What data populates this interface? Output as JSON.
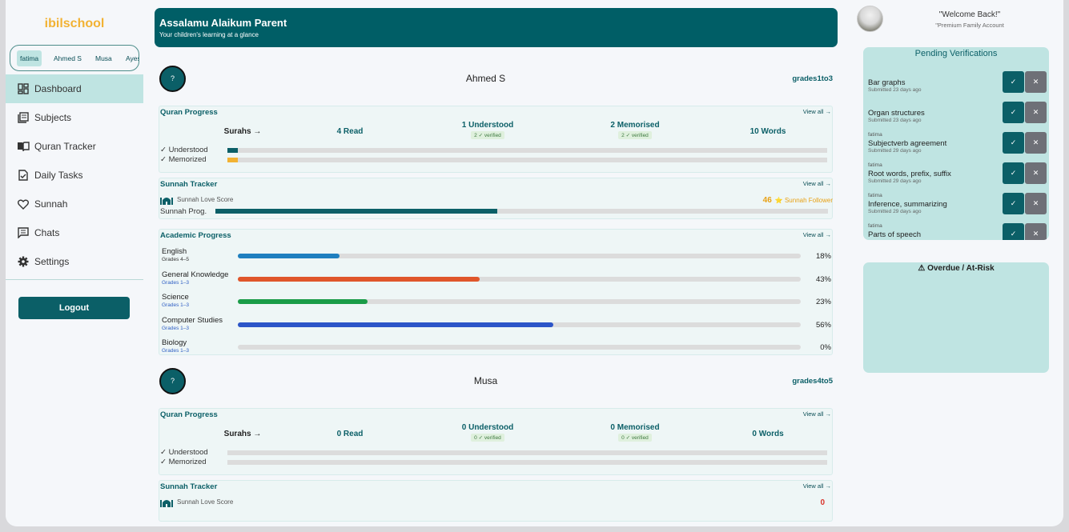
{
  "brand": "ibilschool",
  "child_tabs": [
    "fatima",
    "Ahmed S",
    "Musa",
    "Ayesha"
  ],
  "nav": [
    {
      "label": "Dashboard",
      "icon": "dashboard-icon"
    },
    {
      "label": "Subjects",
      "icon": "books-icon"
    },
    {
      "label": "Quran Tracker",
      "icon": "open-book-icon"
    },
    {
      "label": "Daily Tasks",
      "icon": "task-icon"
    },
    {
      "label": "Sunnah",
      "icon": "heart-icon"
    },
    {
      "label": "Chats",
      "icon": "chat-icon"
    },
    {
      "label": "Settings",
      "icon": "gear-icon"
    }
  ],
  "logout": "Logout",
  "banner": {
    "title": "Assalamu Alaikum Parent",
    "subtitle": "Your children's learning at a glance"
  },
  "header": {
    "welcome": "\"Welcome Back!\"",
    "account": "\"Premium Family Account"
  },
  "children": [
    {
      "avatar": "?",
      "name": "Ahmed S",
      "grade": "grades1to3",
      "quran": {
        "title": "Quran Progress",
        "view_all": "View all →",
        "surahs": "Surahs →",
        "read": "4 Read",
        "understood": "1 Understood",
        "understood_badge": "2 ✓ verified",
        "memorised": "2 Memorised",
        "memorised_badge": "2 ✓ verified",
        "words": "10 Words",
        "understood_label": "✓ Understood",
        "memorized_label": "✓ Memorized",
        "understood_progress": 0.018,
        "memorized_progress": 0.018
      },
      "sunnah": {
        "title": "Sunnah Tracker",
        "view_all": "View all →",
        "love_label": "Sunnah Love Score",
        "score": "46",
        "level": "⭐ Sunnah Follower",
        "prog_label": "Sunnah Prog.",
        "progress": 0.46
      },
      "academic": {
        "title": "Academic Progress",
        "view_all": "View all →",
        "subjects": [
          {
            "name": "English",
            "grade": "Grades 4–5",
            "pct": "18%",
            "value": 0.18,
            "color": "#1f7fbf",
            "grade_color": "#333333"
          },
          {
            "name": "General Knowledge",
            "grade": "Grades 1–3",
            "pct": "43%",
            "value": 0.43,
            "color": "#e0562b",
            "grade_color": "#2f5fc4"
          },
          {
            "name": "Science",
            "grade": "Grades 1–3",
            "pct": "23%",
            "value": 0.23,
            "color": "#1a9c48",
            "grade_color": "#2f5fc4"
          },
          {
            "name": "Computer Studies",
            "grade": "Grades 1–3",
            "pct": "56%",
            "value": 0.56,
            "color": "#2c55c8",
            "grade_color": "#2f5fc4"
          },
          {
            "name": "Biology",
            "grade": "Grades 1–3",
            "pct": "0%",
            "value": 0.0,
            "color": "#2c55c8",
            "grade_color": "#2f5fc4"
          }
        ]
      }
    },
    {
      "avatar": "?",
      "name": "Musa",
      "grade": "grades4to5",
      "quran": {
        "title": "Quran Progress",
        "view_all": "View all →",
        "surahs": "Surahs →",
        "read": "0 Read",
        "understood": "0 Understood",
        "understood_badge": "0 ✓ verified",
        "memorised": "0 Memorised",
        "memorised_badge": "0 ✓ verified",
        "words": "0 Words",
        "understood_label": "✓ Understood",
        "memorized_label": "✓ Memorized",
        "understood_progress": 0,
        "memorized_progress": 0
      },
      "sunnah": {
        "title": "Sunnah Tracker",
        "view_all": "View all →",
        "love_label": "Sunnah Love Score",
        "score": "0"
      }
    }
  ],
  "pending": {
    "title": "Pending Verifications",
    "approve": "✓",
    "reject": "✕",
    "items": [
      {
        "who": "",
        "name": "Bar graphs",
        "when": "Submitted 23 days ago"
      },
      {
        "who": "",
        "name": "Organ structures",
        "when": "Submitted 23 days ago"
      },
      {
        "who": "fatima",
        "name": "Subjectverb agreement",
        "when": "Submitted 29 days ago"
      },
      {
        "who": "fatima",
        "name": "Root words, prefix, suffix",
        "when": "Submitted 29 days ago"
      },
      {
        "who": "fatima",
        "name": "Inference, summarizing",
        "when": "Submitted 29 days ago"
      },
      {
        "who": "fatima",
        "name": "Parts of speech",
        "when": ""
      }
    ]
  },
  "overdue": {
    "title": "⚠ Overdue / At-Risk"
  }
}
